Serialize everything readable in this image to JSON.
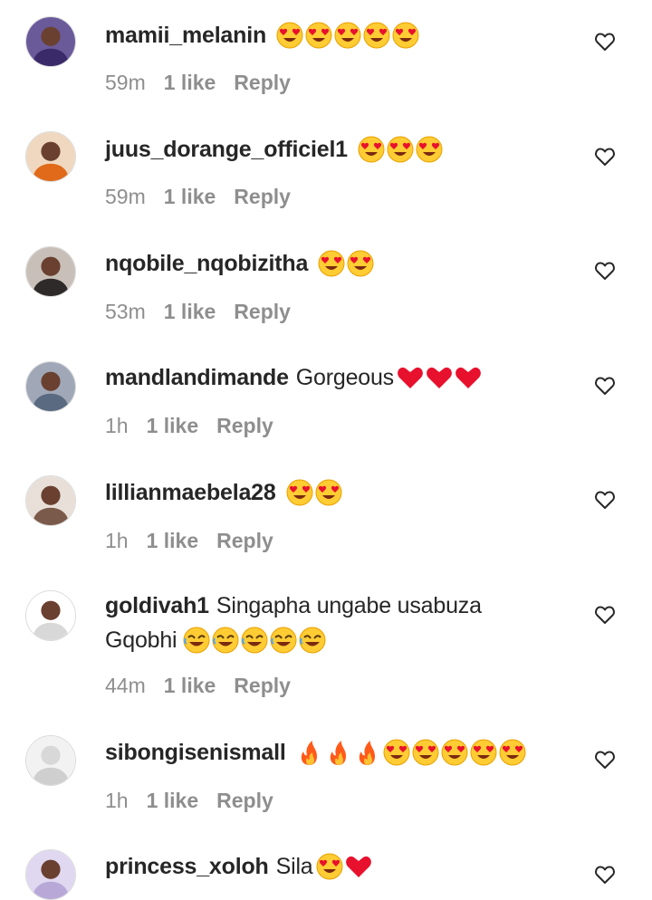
{
  "comments": [
    {
      "username": "mamii_melanin",
      "text": "",
      "emoji": [
        "heart-eyes",
        "heart-eyes",
        "heart-eyes",
        "heart-eyes",
        "heart-eyes"
      ],
      "time": "59m",
      "likes": "1 like",
      "reply": "Reply",
      "avatar_color": "#3a2a6a"
    },
    {
      "username": "juus_dorange_officiel1",
      "text": "",
      "emoji": [
        "heart-eyes",
        "heart-eyes",
        "heart-eyes"
      ],
      "time": "59m",
      "likes": "1 like",
      "reply": "Reply",
      "avatar_color": "#e06a1a"
    },
    {
      "username": "nqobile_nqobizitha",
      "text": "",
      "emoji": [
        "heart-eyes",
        "heart-eyes"
      ],
      "time": "53m",
      "likes": "1 like",
      "reply": "Reply",
      "avatar_color": "#2e2a2a"
    },
    {
      "username": "mandlandimande",
      "text": "Gorgeous",
      "emoji": [
        "red-heart",
        "red-heart",
        "red-heart"
      ],
      "time": "1h",
      "likes": "1 like",
      "reply": "Reply",
      "avatar_color": "#5a6a80"
    },
    {
      "username": "lillianmaebela28",
      "text": "",
      "emoji": [
        "heart-eyes",
        "heart-eyes"
      ],
      "time": "1h",
      "likes": "1 like",
      "reply": "Reply",
      "avatar_color": "#7a5a4a"
    },
    {
      "username": "goldivah1",
      "text": "Singapha ungabe usabuza",
      "text2": "Gqobhi",
      "emoji": [
        "rofl",
        "rofl",
        "rofl",
        "rofl",
        "rofl"
      ],
      "time": "44m",
      "likes": "1 like",
      "reply": "Reply",
      "avatar_color": "#d8d8d8"
    },
    {
      "username": "sibongisenismall",
      "text": "",
      "emoji": [
        "fire",
        "fire",
        "fire",
        "heart-eyes",
        "heart-eyes",
        "heart-eyes",
        "heart-eyes",
        "heart-eyes"
      ],
      "time": "1h",
      "likes": "1 like",
      "reply": "Reply",
      "avatar_color": "#cfcfcf"
    },
    {
      "username": "princess_xoloh",
      "text": "Sila",
      "emoji": [
        "heart-eyes",
        "red-heart"
      ],
      "avatar_color": "#b8a8d8"
    }
  ],
  "colors": {
    "text": "#262626",
    "meta": "#8e8e8e",
    "heart_red": "#e8112d",
    "emoji_yellow": "#ffcc33"
  }
}
